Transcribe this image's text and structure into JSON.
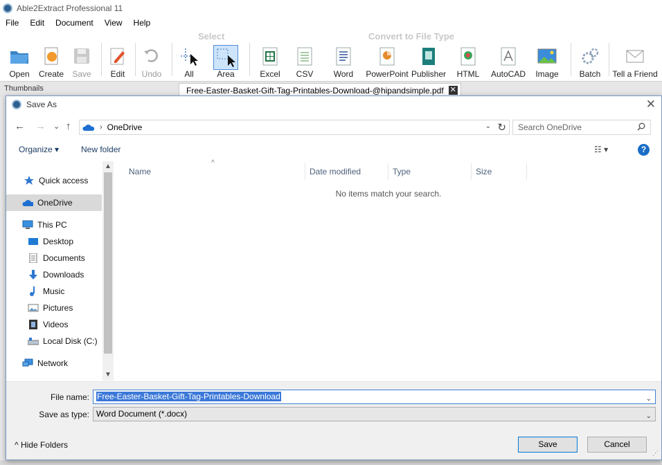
{
  "app": {
    "title": "Able2Extract Professional 11",
    "menu": [
      "File",
      "Edit",
      "Document",
      "View",
      "Help"
    ],
    "groups": {
      "select": "Select",
      "convert": "Convert to File Type"
    },
    "toolbar": {
      "open": "Open",
      "create": "Create",
      "save": "Save",
      "edit": "Edit",
      "undo": "Undo",
      "all": "All",
      "area": "Area",
      "excel": "Excel",
      "csv": "CSV",
      "word": "Word",
      "powerpoint": "PowerPoint",
      "publisher": "Publisher",
      "html": "HTML",
      "autocad": "AutoCAD",
      "image": "Image",
      "batch": "Batch",
      "tell_friend": "Tell a Friend"
    },
    "thumbnails_tab": "Thumbnails",
    "document_tab": "Free-Easter-Basket-Gift-Tag-Printables-Download-@hipandsimple.pdf",
    "doc_tab_close": "✕"
  },
  "dialog": {
    "title": "Save As",
    "close": "✕",
    "nav": {
      "back": "←",
      "forward": "→",
      "recent": "⌄",
      "up": "↑"
    },
    "address": {
      "location": "OneDrive",
      "chevron": "›",
      "dropdown": "⌄",
      "refresh": "↻"
    },
    "search_placeholder": "Search OneDrive",
    "commands": {
      "organize": "Organize ▾",
      "new_folder": "New folder",
      "view": "☷ ▾",
      "help": "?"
    },
    "nav_pane": {
      "items": [
        {
          "label": "Quick access"
        },
        {
          "label": "OneDrive"
        },
        {
          "label": "This PC"
        },
        {
          "label": "Desktop"
        },
        {
          "label": "Documents"
        },
        {
          "label": "Downloads"
        },
        {
          "label": "Music"
        },
        {
          "label": "Pictures"
        },
        {
          "label": "Videos"
        },
        {
          "label": "Local Disk (C:)"
        },
        {
          "label": "Network"
        }
      ],
      "scroll_up": "▲",
      "scroll_down": "▼"
    },
    "columns": [
      "Name",
      "Date modified",
      "Type",
      "Size"
    ],
    "sort_arrow": "^",
    "empty_message": "No items match your search.",
    "file_name_label": "File name:",
    "file_name_value": "Free-Easter-Basket-Gift-Tag-Printables-Download",
    "save_type_label": "Save as type:",
    "save_type_value": "Word Document (*.docx)",
    "dropdown_arrow": "⌄",
    "hide_folders": "^  Hide Folders",
    "save_button": "Save",
    "cancel_button": "Cancel"
  },
  "colors": {
    "accent": "#0078d7",
    "selection": "#3b78d8",
    "onedrive": "#1e6fd0",
    "nav_selected": "#d9d9d9"
  }
}
